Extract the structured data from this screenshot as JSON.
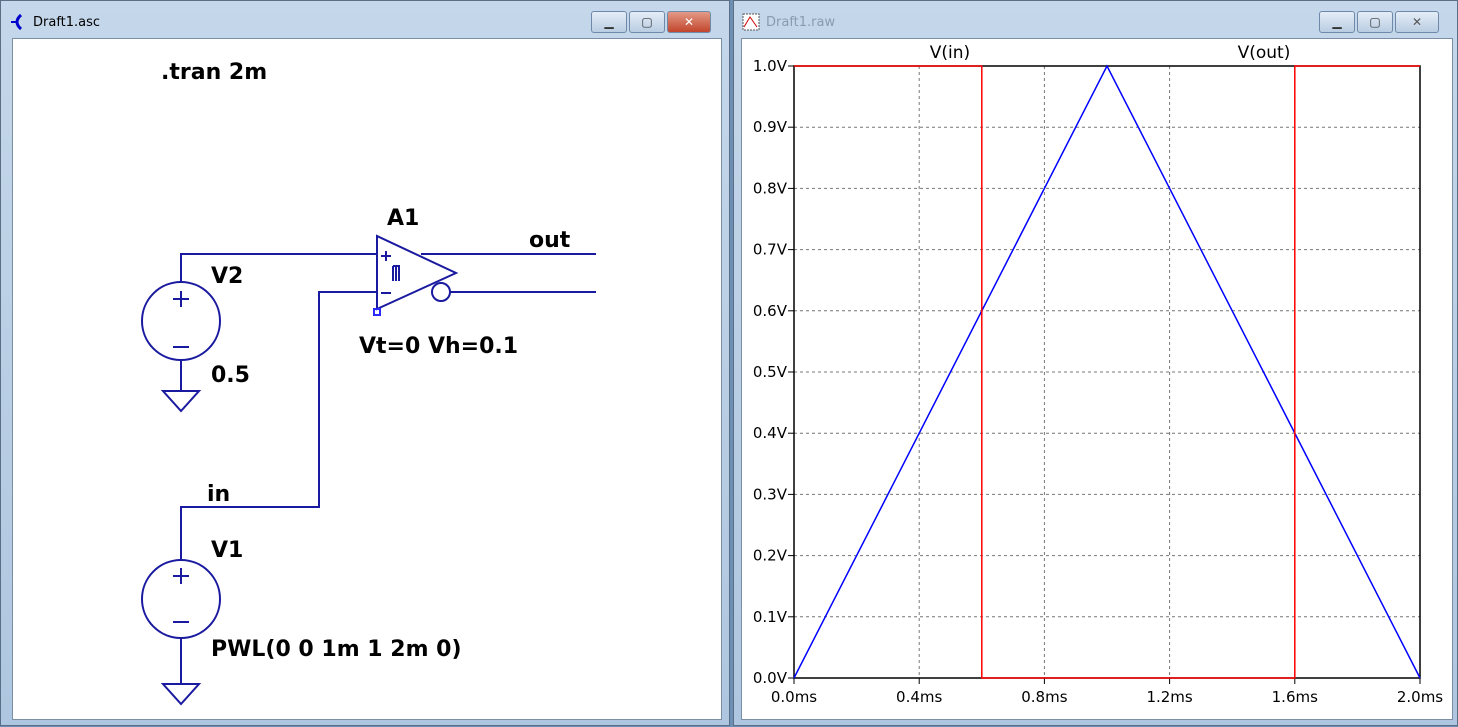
{
  "left_window": {
    "title": "Draft1.asc",
    "icon": "ltspice-schematic-icon"
  },
  "right_window": {
    "title": "Draft1.raw",
    "icon": "waveform-icon"
  },
  "schematic": {
    "directive": ".tran 2m",
    "comparator": {
      "name": "A1",
      "params": "Vt=0 Vh=0.1"
    },
    "net_out": "out",
    "net_in": "in",
    "v2": {
      "name": "V2",
      "value": "0.5"
    },
    "v1": {
      "name": "V1",
      "value": "PWL(0 0 1m 1 2m 0)"
    }
  },
  "chart_data": {
    "type": "line",
    "xlabel": "",
    "ylabel": "",
    "xlim": [
      0,
      2
    ],
    "ylim": [
      0,
      1
    ],
    "x_ticks": [
      "0.0ms",
      "0.4ms",
      "0.8ms",
      "1.2ms",
      "1.6ms",
      "2.0ms"
    ],
    "x_tick_values": [
      0,
      0.4,
      0.8,
      1.2,
      1.6,
      2.0
    ],
    "y_ticks": [
      "0.0V",
      "0.1V",
      "0.2V",
      "0.3V",
      "0.4V",
      "0.5V",
      "0.6V",
      "0.7V",
      "0.8V",
      "0.9V",
      "1.0V"
    ],
    "grid": true,
    "series": [
      {
        "name": "V(in)",
        "color": "#0000ff",
        "points": [
          [
            0,
            0
          ],
          [
            1,
            1
          ],
          [
            2,
            0
          ]
        ]
      },
      {
        "name": "V(out)",
        "color": "#ff0000",
        "points": [
          [
            0,
            1
          ],
          [
            0.6,
            1
          ],
          [
            0.6,
            0
          ],
          [
            1.6,
            0
          ],
          [
            1.6,
            1
          ],
          [
            2,
            1
          ]
        ]
      }
    ]
  }
}
